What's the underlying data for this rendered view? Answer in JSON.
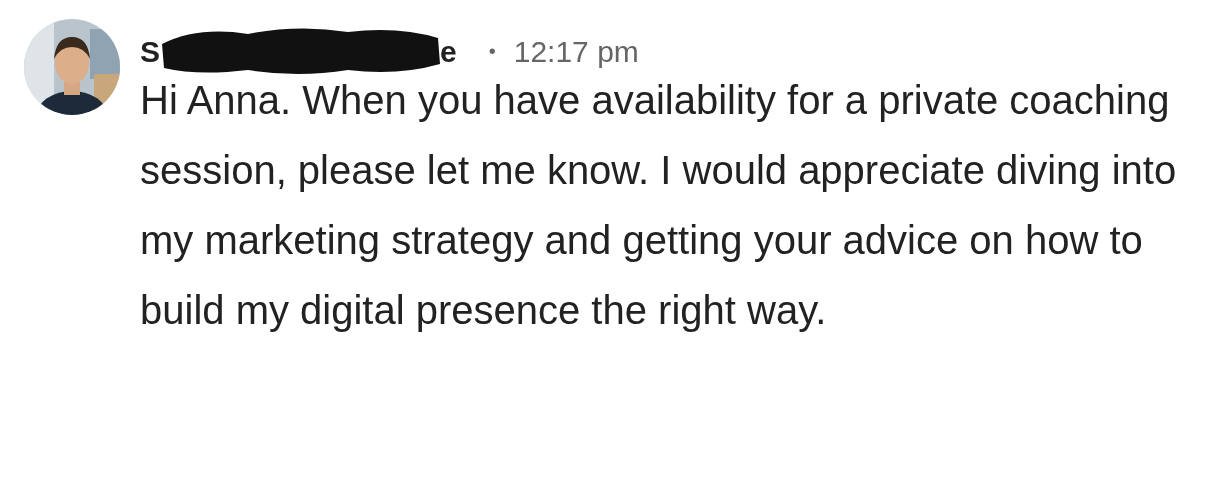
{
  "message": {
    "sender_name_start": "S",
    "name_redacted": true,
    "sender_name_end": "e",
    "separator": "•",
    "time": "12:17 pm",
    "text": "Hi Anna. When you have availability for a private coaching session, please let me know. I would appreciate diving into my marketing strategy and getting your advice on how to build my digital presence the right way."
  }
}
